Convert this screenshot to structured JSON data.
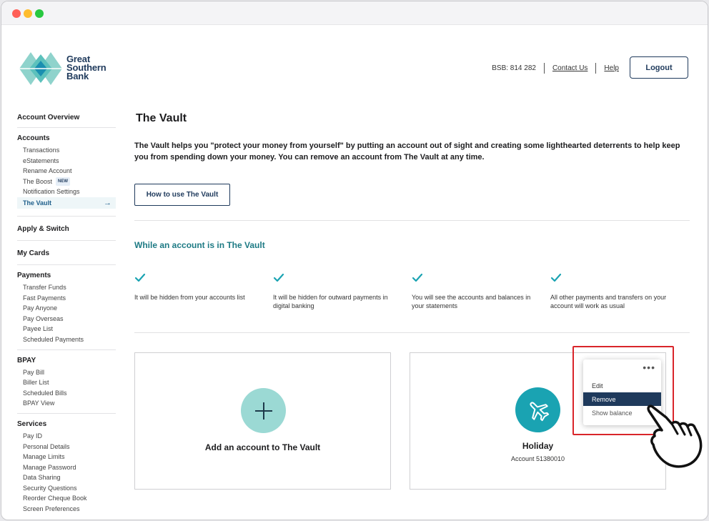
{
  "brand": {
    "logo_lines": [
      "Great",
      "Southern",
      "Bank"
    ],
    "colors": {
      "navy": "#1f3a5c",
      "teal": "#1aa3b2",
      "light_teal": "#9bd9d4",
      "heading_teal": "#1d7a84",
      "highlight_red": "#d9252a"
    }
  },
  "header": {
    "bsb": "BSB: 814 282",
    "contact_label": "Contact Us",
    "help_label": "Help",
    "logout_label": "Logout"
  },
  "sidebar": {
    "overview": "Account Overview",
    "accounts": {
      "title": "Accounts",
      "items": [
        "Transactions",
        "eStatements",
        "Rename Account",
        "The Boost",
        "Notification Settings",
        "The Vault"
      ],
      "new_badge": "NEW"
    },
    "apply_switch": "Apply & Switch",
    "my_cards": "My Cards",
    "payments": {
      "title": "Payments",
      "items": [
        "Transfer Funds",
        "Fast Payments",
        "Pay Anyone",
        "Pay Overseas",
        "Payee List",
        "Scheduled Payments"
      ]
    },
    "bpay": {
      "title": "BPAY",
      "items": [
        "Pay Bill",
        "Biller List",
        "Scheduled Bills",
        "BPAY View"
      ]
    },
    "services": {
      "title": "Services",
      "items": [
        "Pay ID",
        "Personal Details",
        "Manage Limits",
        "Manage Password",
        "Data Sharing",
        "Security Questions",
        "Reorder Cheque Book",
        "Screen Preferences"
      ]
    }
  },
  "main": {
    "title": "The Vault",
    "intro": "The Vault helps you \"protect your money from yourself\" by putting an account out of sight and creating some lighthearted deterrents to help keep you from spending down your money. You can remove an account from The Vault at any time.",
    "how_to_label": "How to use The Vault",
    "while_title": "While an account is in The Vault",
    "features": [
      "It will be hidden from your accounts list",
      "It will be hidden for outward payments in digital banking",
      "You will see the accounts and balances in your statements",
      "All other payments and transfers on your account will work as usual"
    ],
    "add_card_label": "Add an account to The Vault",
    "account": {
      "name": "Holiday",
      "number": "Account 51380010"
    },
    "menu": {
      "items": [
        "Edit",
        "Remove",
        "Show balance"
      ],
      "selected": "Remove"
    }
  }
}
